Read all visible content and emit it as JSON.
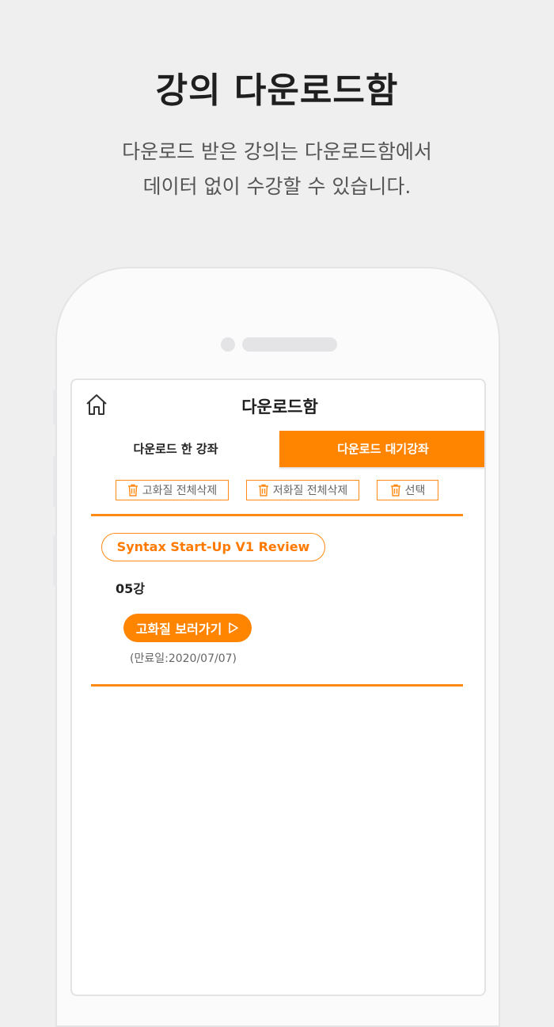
{
  "promo": {
    "headline": "강의 다운로드함",
    "subtitle_line1": "다운로드 받은 강의는 다운로드함에서",
    "subtitle_line2": "데이터 없이 수강할 수 있습니다."
  },
  "screen": {
    "title": "다운로드함",
    "tabs": [
      {
        "label": "다운로드 한 강좌",
        "active": false
      },
      {
        "label": "다운로드 대기강좌",
        "active": true
      }
    ],
    "actions": [
      {
        "label": "고화질 전체삭제",
        "icon": "trash-icon"
      },
      {
        "label": "저화질 전체삭제",
        "icon": "trash-icon"
      },
      {
        "label": "선택",
        "icon": "trash-icon"
      }
    ],
    "course": {
      "name": "Syntax Start-Up V1 Review",
      "lecture": "05강",
      "watch_button": "고화질 보러가기",
      "expiry": "(만료일:2020/07/07)"
    }
  },
  "colors": {
    "accent": "#ff8400",
    "background": "#efeff0"
  }
}
